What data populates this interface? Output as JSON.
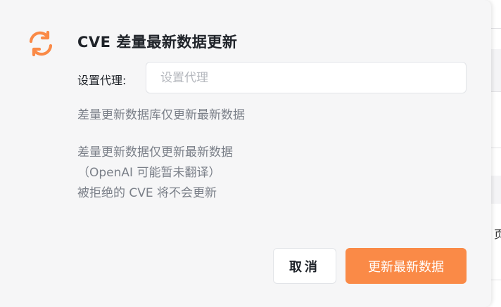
{
  "dialog": {
    "title": "CVE 差量最新数据更新",
    "icon": "refresh-icon",
    "accent_color": "#fa8a47",
    "proxy": {
      "label": "设置代理:",
      "placeholder": "设置代理",
      "value": ""
    },
    "description_1": "差量更新数据库仅更新最新数据",
    "description_2": [
      "差量更新数据仅更新最新数据",
      "（OpenAI 可能暂未翻译）",
      "被拒绝的 CVE 将不会更新"
    ],
    "buttons": {
      "cancel_label": "取消",
      "confirm_label": "更新最新数据"
    }
  },
  "background": {
    "partial_char": "页"
  }
}
